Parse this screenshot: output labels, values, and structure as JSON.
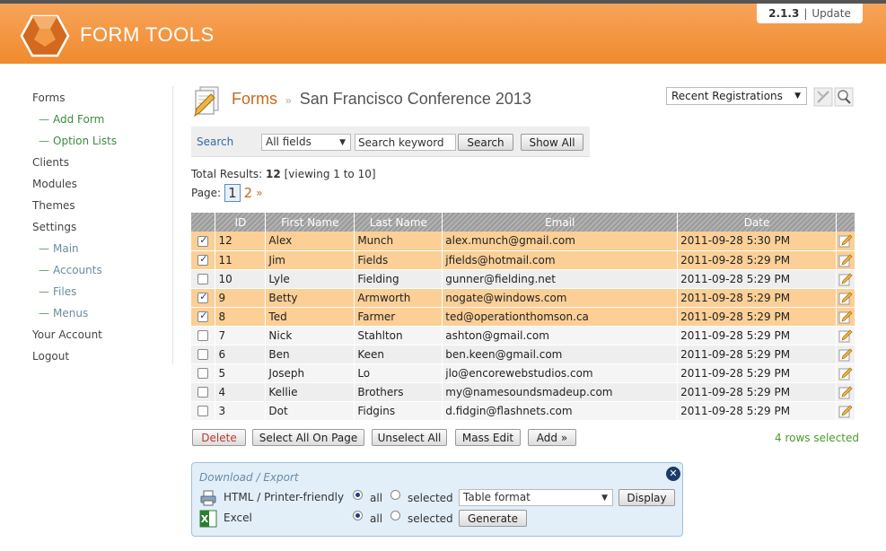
{
  "header": {
    "brand": "FORM TOOLS",
    "version": "2.1.3",
    "separator": "|",
    "update_link": "Update"
  },
  "sidebar": {
    "items": [
      {
        "label": "Forms",
        "level": 0
      },
      {
        "label": "Add Form",
        "level": 1
      },
      {
        "label": "Option Lists",
        "level": 1
      },
      {
        "label": "Clients",
        "level": 0
      },
      {
        "label": "Modules",
        "level": 0
      },
      {
        "label": "Themes",
        "level": 0
      },
      {
        "label": "Settings",
        "level": 0
      },
      {
        "label": "Main",
        "level": 1
      },
      {
        "label": "Accounts",
        "level": 1
      },
      {
        "label": "Files",
        "level": 1
      },
      {
        "label": "Menus",
        "level": 1
      },
      {
        "label": "Your Account",
        "level": 0
      },
      {
        "label": "Logout",
        "level": 0
      }
    ],
    "sub_prefix": "—"
  },
  "title": {
    "forms": "Forms",
    "separator": "»",
    "form_name": "San Francisco Conference 2013"
  },
  "view_select": {
    "value": "Recent Registrations"
  },
  "search": {
    "label": "Search",
    "field_select": "All fields",
    "keyword_placeholder": "Search keyword",
    "search_button": "Search",
    "show_all_button": "Show All"
  },
  "results": {
    "prefix": "Total Results:",
    "total": "12",
    "viewing": "[viewing 1 to 10]",
    "page_label": "Page:",
    "current_page": "1",
    "next_page": "2",
    "next_arrow": "»"
  },
  "table": {
    "columns": [
      "ID",
      "First Name",
      "Last Name",
      "Email",
      "Date"
    ],
    "rows": [
      {
        "id": "12",
        "first": "Alex",
        "last": "Munch",
        "email": "alex.munch@gmail.com",
        "date": "2011-09-28 5:30 PM",
        "selected": true
      },
      {
        "id": "11",
        "first": "Jim",
        "last": "Fields",
        "email": "jfields@hotmail.com",
        "date": "2011-09-28 5:29 PM",
        "selected": true
      },
      {
        "id": "10",
        "first": "Lyle",
        "last": "Fielding",
        "email": "gunner@fielding.net",
        "date": "2011-09-28 5:29 PM",
        "selected": false
      },
      {
        "id": "9",
        "first": "Betty",
        "last": "Armworth",
        "email": "nogate@windows.com",
        "date": "2011-09-28 5:29 PM",
        "selected": true
      },
      {
        "id": "8",
        "first": "Ted",
        "last": "Farmer",
        "email": "ted@operationthomson.ca",
        "date": "2011-09-28 5:29 PM",
        "selected": true
      },
      {
        "id": "7",
        "first": "Nick",
        "last": "Stahlton",
        "email": "ashton@gmail.com",
        "date": "2011-09-28 5:29 PM",
        "selected": false
      },
      {
        "id": "6",
        "first": "Ben",
        "last": "Keen",
        "email": "ben.keen@gmail.com",
        "date": "2011-09-28 5:29 PM",
        "selected": false
      },
      {
        "id": "5",
        "first": "Joseph",
        "last": "Lo",
        "email": "jlo@encorewebstudios.com",
        "date": "2011-09-28 5:29 PM",
        "selected": false
      },
      {
        "id": "4",
        "first": "Kellie",
        "last": "Brothers",
        "email": "my@namesoundsmadeup.com",
        "date": "2011-09-28 5:29 PM",
        "selected": false
      },
      {
        "id": "3",
        "first": "Dot",
        "last": "Fidgins",
        "email": "d.fidgin@flashnets.com",
        "date": "2011-09-28 5:29 PM",
        "selected": false
      }
    ]
  },
  "actions": {
    "delete": "Delete",
    "select_all": "Select All On Page",
    "unselect_all": "Unselect All",
    "mass_edit": "Mass Edit",
    "add": "Add »",
    "rows_selected": "4 rows selected"
  },
  "export": {
    "title": "Download / Export",
    "html_label": "HTML / Printer-friendly",
    "excel_label": "Excel",
    "all": "all",
    "selected": "selected",
    "format_value": "Table format",
    "display_button": "Display",
    "generate_button": "Generate"
  },
  "colors": {
    "header_orange": "#f08a2e",
    "selected_row": "#fbcf96",
    "link_orange": "#c56a1c",
    "green_text": "#4a9a2a"
  }
}
